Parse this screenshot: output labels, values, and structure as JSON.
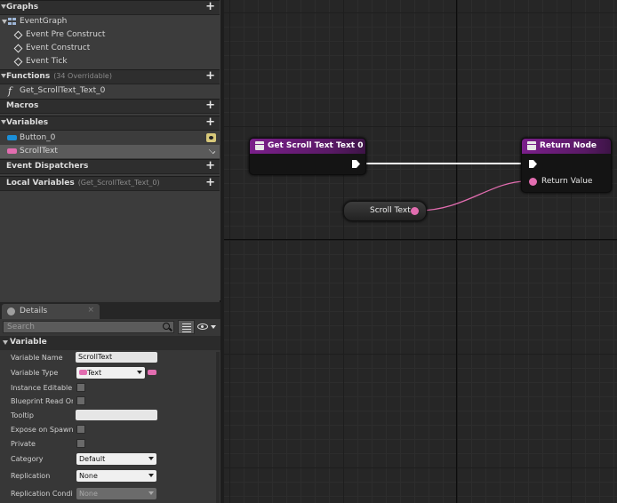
{
  "my_blueprint": {
    "graphs": {
      "label": "Graphs",
      "items": [
        {
          "label": "EventGraph"
        },
        {
          "label": "Event Pre Construct"
        },
        {
          "label": "Event Construct"
        },
        {
          "label": "Event Tick"
        }
      ]
    },
    "functions": {
      "label": "Functions",
      "count": "(34 Overridable)",
      "items": [
        {
          "label": "Get_ScrollText_Text_0"
        }
      ]
    },
    "macros": {
      "label": "Macros"
    },
    "variables": {
      "label": "Variables",
      "items": [
        {
          "label": "Button_0",
          "color": "#1b8fd8"
        },
        {
          "label": "ScrollText",
          "color": "#e26db0"
        }
      ]
    },
    "event_dispatchers": {
      "label": "Event Dispatchers"
    },
    "local_variables": {
      "label": "Local Variables",
      "sub": "(Get_ScrollText_Text_0)"
    }
  },
  "details": {
    "tab_label": "Details",
    "search_placeholder": "Search",
    "category": "Variable",
    "props": {
      "variable_name": {
        "label": "Variable Name",
        "value": "ScrollText"
      },
      "variable_type": {
        "label": "Variable Type",
        "value": "Text",
        "color": "#e26db0"
      },
      "instance_editable": {
        "label": "Instance Editable"
      },
      "blueprint_read_only": {
        "label": "Blueprint Read Onl"
      },
      "tooltip": {
        "label": "Tooltip",
        "value": ""
      },
      "expose_on_spawn": {
        "label": "Expose on Spawn"
      },
      "private": {
        "label": "Private"
      },
      "category": {
        "label": "Category",
        "value": "Default"
      },
      "replication": {
        "label": "Replication",
        "value": "None"
      },
      "replication_condition": {
        "label": "Replication Conditi",
        "value": "None"
      }
    }
  },
  "graph": {
    "nodes": {
      "function_entry": {
        "title": "Get Scroll Text Text 0"
      },
      "return_node": {
        "title": "Return Node",
        "pin": "Return Value"
      },
      "getter": {
        "title": "Scroll Text"
      }
    },
    "colors": {
      "exec": "#ffffff",
      "text_pin": "#e26db0",
      "function_header": "#7a1f8a"
    }
  }
}
